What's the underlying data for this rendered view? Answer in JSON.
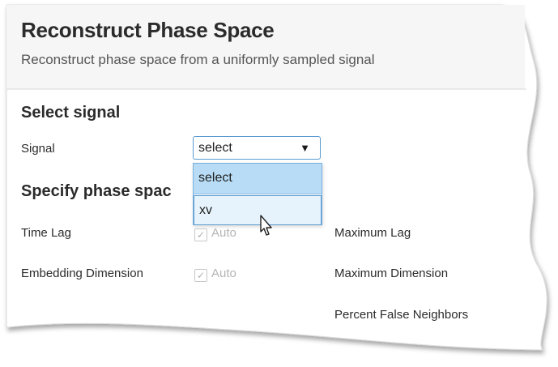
{
  "header": {
    "title": "Reconstruct Phase Space",
    "subtitle": "Reconstruct phase space from a uniformly sampled signal"
  },
  "select_signal": {
    "heading": "Select signal",
    "signal_label": "Signal",
    "signal_value": "select",
    "dropdown_arrow_icon": "triangle-down-icon",
    "options": [
      "select",
      "xv"
    ],
    "highlighted_option": "xv"
  },
  "phase_space": {
    "heading": "Specify phase spac",
    "time_lag_label": "Time Lag",
    "time_lag_auto_label": "Auto",
    "time_lag_auto_checked": true,
    "embedding_label": "Embedding Dimension",
    "embedding_auto_label": "Auto",
    "embedding_auto_checked": true,
    "max_lag_label": "Maximum Lag",
    "max_dimension_label": "Maximum Dimension",
    "percent_false_label": "Percent False Neighbors"
  },
  "colors": {
    "accent_border": "#5a9ad0",
    "selected_option_bg": "#b8dcf5",
    "hover_option_bg": "#e6f3fc",
    "disabled_text": "#b4b4b4"
  }
}
